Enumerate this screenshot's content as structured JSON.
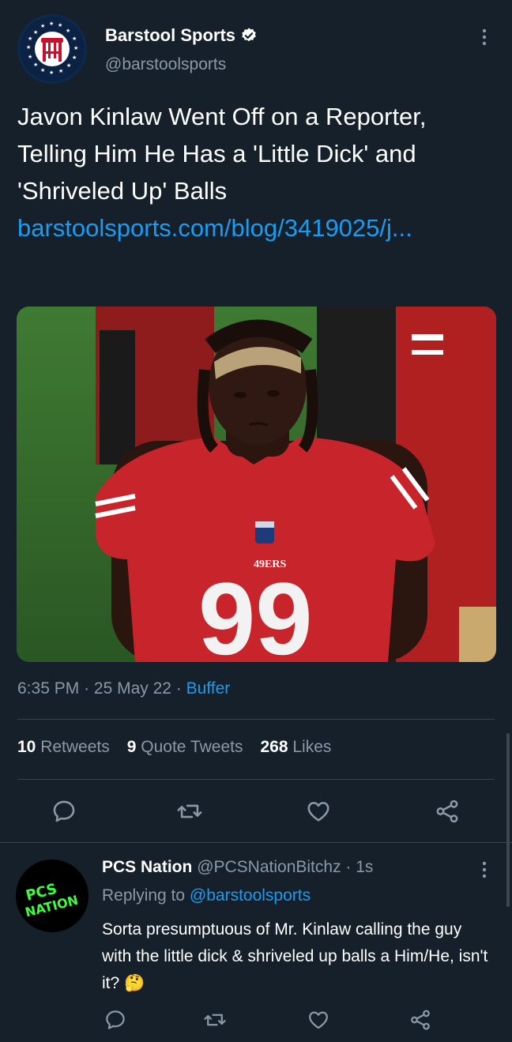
{
  "tweet": {
    "author_name": "Barstool Sports",
    "author_handle": "@barstoolsports",
    "text": "Javon Kinlaw Went Off on a Reporter, Telling Him He Has a 'Little Dick' and 'Shriveled Up' Balls",
    "link": "barstoolsports.com/blog/3419025/j...",
    "media_jersey_number": "99",
    "media_jersey_text": "49ERS",
    "time": "6:35 PM",
    "date": "25 May 22",
    "source": "Buffer",
    "retweets_count": "10",
    "retweets_label": "Retweets",
    "quotes_count": "9",
    "quotes_label": "Quote Tweets",
    "likes_count": "268",
    "likes_label": "Likes"
  },
  "reply": {
    "author_name": "PCS Nation",
    "author_handle": "@PCSNationBitchz",
    "time": "1s",
    "replying_label": "Replying to",
    "replying_handle": "@barstoolsports",
    "text": "Sorta presumptuous of Mr. Kinlaw calling the guy with the little dick & shriveled up balls a Him/He, isn't it? 🤔",
    "avatar_text_1": "PCS",
    "avatar_text_2": "NATION"
  },
  "icons": [
    "verified-icon",
    "more-icon",
    "reply-icon",
    "retweet-icon",
    "like-icon",
    "share-icon"
  ],
  "colors": {
    "background": "#15202b",
    "link": "#1d9bf0",
    "muted": "#8b98a5",
    "divider": "#38444d"
  }
}
